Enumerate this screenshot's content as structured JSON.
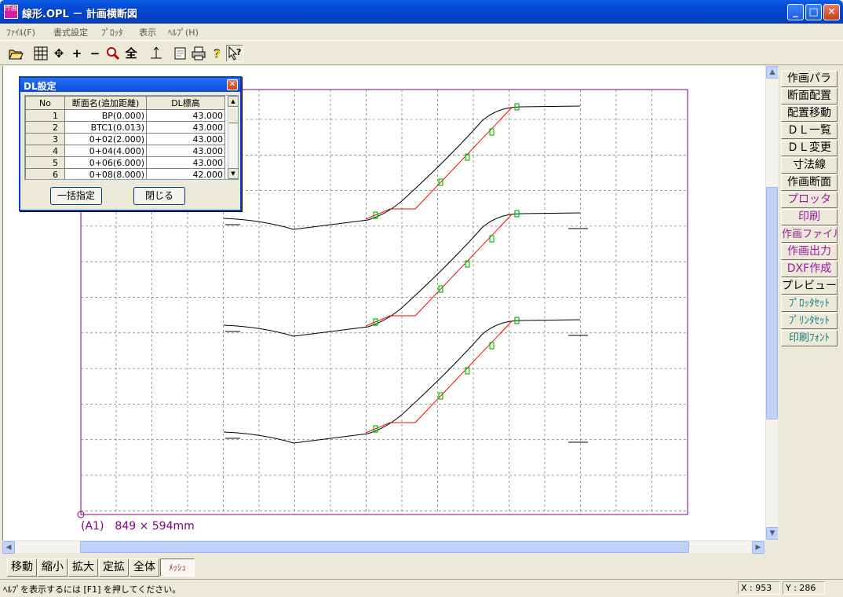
{
  "window": {
    "app_icon_text": "作画",
    "title": "線形.OPL － 計画横断図",
    "minimize_glyph": "_",
    "maximize_glyph": "□",
    "close_glyph": "✕"
  },
  "menu": [
    "ﾌｧｲﾙ(F)",
    "書式設定",
    "ﾌﾟﾛｯﾀ",
    "表示",
    "ﾍﾙﾌﾟ(H)"
  ],
  "toolbar": {
    "icons": [
      "open-folder-icon",
      "grid-icon",
      "pan-icon",
      "zoom-in-icon",
      "zoom-out-icon",
      "zoom-window-icon",
      "zoom-all-icon",
      "measure-icon",
      "preview-icon",
      "print-icon",
      "help-icon",
      "context-help-icon"
    ],
    "zoom_all_label": "全"
  },
  "side_panel": [
    {
      "label": "作画パラ",
      "color": "black"
    },
    {
      "label": "断面配置",
      "color": "black"
    },
    {
      "label": "配置移動",
      "color": "black"
    },
    {
      "label": "ＤＬ一覧",
      "color": "black"
    },
    {
      "label": "ＤＬ変更",
      "color": "black"
    },
    {
      "label": "寸法線",
      "color": "black"
    },
    {
      "label": "作画断面",
      "color": "black"
    },
    {
      "label": "プロッタ",
      "color": "purple"
    },
    {
      "label": "印刷",
      "color": "purple"
    },
    {
      "label": "作画ファイル",
      "color": "purple"
    },
    {
      "label": "作画出力",
      "color": "purple"
    },
    {
      "label": "DXF作成",
      "color": "purple"
    },
    {
      "label": "プレビュー",
      "color": "black"
    },
    {
      "label": "ﾌﾟﾛｯﾀｾｯﾄ",
      "color": "teal"
    },
    {
      "label": "ﾌﾟﾘﾝﾀｾｯﾄ",
      "color": "teal"
    },
    {
      "label": "印刷ﾌｫﾝﾄ",
      "color": "teal"
    }
  ],
  "bottom_tabs": [
    "移動",
    "縮小",
    "拡大",
    "定拡",
    "全体",
    "ﾒｯｼｭ"
  ],
  "active_tab": "ﾒｯｼｭ",
  "paper_label": "(A1)　849 × 594mm",
  "status": {
    "help_text": "ﾍﾙﾌﾟを表示するには [F1] を押してください。",
    "x": "X : 953",
    "y": "Y : 286"
  },
  "dialog": {
    "title": "DL設定",
    "columns": [
      "No",
      "断面名(追加距離)",
      "DL標高"
    ],
    "rows": [
      {
        "no": "1",
        "name": "BP(0.000)",
        "elev": "43.000"
      },
      {
        "no": "2",
        "name": "BTC1(0.013)",
        "elev": "43.000"
      },
      {
        "no": "3",
        "name": "0+02(2.000)",
        "elev": "43.000"
      },
      {
        "no": "4",
        "name": "0+04(4.000)",
        "elev": "43.000"
      },
      {
        "no": "5",
        "name": "0+06(6.000)",
        "elev": "43.000"
      },
      {
        "no": "6",
        "name": "0+08(8.000)",
        "elev": "42.000"
      }
    ],
    "bulk_button": "一括指定",
    "close_button": "閉じる"
  },
  "colors": {
    "frame": "#800080",
    "design_line": "#ff0000",
    "marker": "#00c000",
    "ground_line": "#000000",
    "grid": "#808080"
  }
}
